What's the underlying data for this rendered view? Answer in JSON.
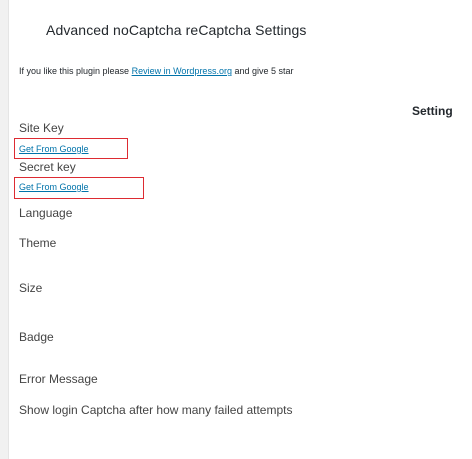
{
  "page": {
    "title": "Advanced noCaptcha reCaptcha Settings",
    "section_heading": "Setting"
  },
  "promo": {
    "prefix": "If you like this plugin please ",
    "link_text": "Review in Wordpress.org",
    "suffix": " and give 5 star"
  },
  "fields": {
    "site_key": {
      "label": "Site Key",
      "link": "Get From Google"
    },
    "secret_key": {
      "label": "Secret key",
      "link": "Get From Google"
    },
    "language": {
      "label": "Language"
    },
    "theme": {
      "label": "Theme"
    },
    "size": {
      "label": "Size"
    },
    "badge": {
      "label": "Badge"
    },
    "error_message": {
      "label": "Error Message"
    },
    "login_attempts": {
      "label": "Show login Captcha after how many failed attempts"
    }
  },
  "colors": {
    "link": "#0073aa",
    "highlight_border": "#dd2b32",
    "text": "#444444"
  }
}
